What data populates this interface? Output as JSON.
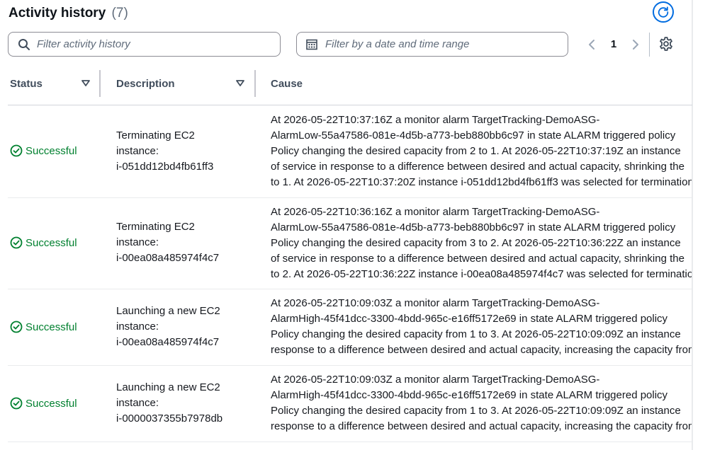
{
  "header": {
    "title": "Activity history",
    "count": "(7)"
  },
  "filters": {
    "text_placeholder": "Filter activity history",
    "date_placeholder": "Filter by a date and time range"
  },
  "pagination": {
    "current_page": "1"
  },
  "table": {
    "columns": [
      "Status",
      "Description",
      "Cause"
    ],
    "rows": [
      {
        "status": "Successful",
        "description": [
          "Terminating EC2",
          "instance:",
          "i-051dd12bd4fb61ff3"
        ],
        "cause": [
          "At 2026-05-22T10:37:16Z a monitor alarm TargetTracking-DemoASG-",
          "AlarmLow-55a47586-081e-4d5b-a773-beb880bb6c97 in state ALARM triggered policy",
          "Policy changing the desired capacity from 2 to 1. At 2026-05-22T10:37:19Z an instance",
          "of service in response to a difference between desired and actual capacity, shrinking the",
          "to 1. At 2026-05-22T10:37:20Z instance i-051dd12bd4fb61ff3 was selected for termination"
        ]
      },
      {
        "status": "Successful",
        "description": [
          "Terminating EC2",
          "instance:",
          "i-00ea08a485974f4c7"
        ],
        "cause": [
          "At 2026-05-22T10:36:16Z a monitor alarm TargetTracking-DemoASG-",
          "AlarmLow-55a47586-081e-4d5b-a773-beb880bb6c97 in state ALARM triggered policy",
          "Policy changing the desired capacity from 3 to 2. At 2026-05-22T10:36:22Z an instance",
          "of service in response to a difference between desired and actual capacity, shrinking the",
          "to 2. At 2026-05-22T10:36:22Z instance i-00ea08a485974f4c7 was selected for termination"
        ]
      },
      {
        "status": "Successful",
        "description": [
          "Launching a new EC2",
          "instance:",
          "i-00ea08a485974f4c7"
        ],
        "cause": [
          "At 2026-05-22T10:09:03Z a monitor alarm TargetTracking-DemoASG-",
          "AlarmHigh-45f41dcc-3300-4bdd-965c-e16ff5172e69 in state ALARM triggered policy",
          "Policy changing the desired capacity from 1 to 3. At 2026-05-22T10:09:09Z an instance",
          "response to a difference between desired and actual capacity, increasing the capacity from"
        ]
      },
      {
        "status": "Successful",
        "description": [
          "Launching a new EC2",
          "instance:",
          "i-0000037355b7978db"
        ],
        "cause": [
          "At 2026-05-22T10:09:03Z a monitor alarm TargetTracking-DemoASG-",
          "AlarmHigh-45f41dcc-3300-4bdd-965c-e16ff5172e69 in state ALARM triggered policy",
          "Policy changing the desired capacity from 1 to 3. At 2026-05-22T10:09:09Z an instance",
          "response to a difference between desired and actual capacity, increasing the capacity from"
        ]
      }
    ]
  },
  "icons": {
    "refresh": "refresh-icon",
    "search": "search-icon",
    "calendar": "calendar-icon",
    "prev": "chevron-left-icon",
    "next": "chevron-right-icon",
    "settings": "gear-icon",
    "sort": "sort-down-icon",
    "status": "check-circle-icon"
  },
  "colors": {
    "accent": "#006ce0",
    "success": "#00802f",
    "heading": "#0f141a",
    "muted": "#5f6b7a"
  }
}
